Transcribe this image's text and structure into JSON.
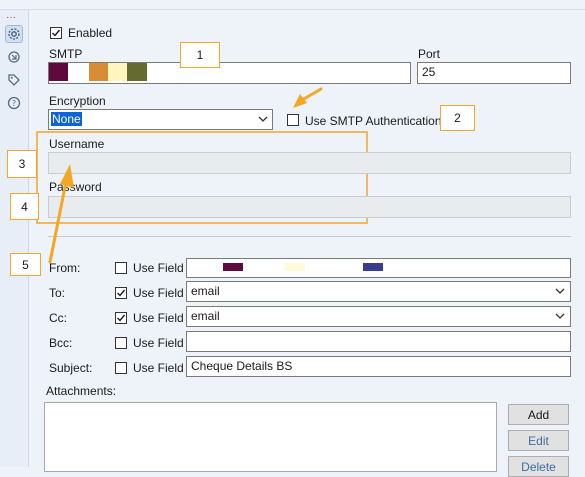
{
  "window": {
    "title_fragment": ""
  },
  "rail": {
    "dots": "···",
    "icons": [
      "gear-icon",
      "refresh-arrows-icon",
      "tag-icon",
      "help-icon"
    ]
  },
  "enabled": {
    "label": "Enabled",
    "checked": true
  },
  "smtp": {
    "label": "SMTP",
    "value": "",
    "redaction_colors": [
      "#5e0a3e",
      "#d88c36",
      "#fff5c0",
      "#656a30"
    ]
  },
  "port": {
    "label": "Port",
    "value": "25"
  },
  "encryption": {
    "label": "Encryption",
    "value": "None"
  },
  "smtp_auth": {
    "label": "Use SMTP Authentication",
    "checked": false
  },
  "username": {
    "label": "Username",
    "value": ""
  },
  "password": {
    "label": "Password",
    "value": ""
  },
  "callouts": {
    "c1": "1",
    "c2": "2",
    "c3": "3",
    "c4": "4",
    "c5": "5"
  },
  "fields": {
    "use_field_label": "Use Field",
    "from": {
      "label": "From:",
      "use_field": false,
      "value": "",
      "redaction_colors": [
        "#5e0a3e",
        "#fffbd8",
        "#3b3d8a"
      ]
    },
    "to": {
      "label": "To:",
      "use_field": true,
      "value": "email"
    },
    "cc": {
      "label": "Cc:",
      "use_field": true,
      "value": "email"
    },
    "bcc": {
      "label": "Bcc:",
      "use_field": false,
      "value": ""
    },
    "subject": {
      "label": "Subject:",
      "use_field": false,
      "value": "Cheque Details BS"
    }
  },
  "attachments": {
    "label": "Attachments:"
  },
  "buttons": {
    "add": "Add",
    "edit": "Edit",
    "delete": "Delete"
  },
  "colors": {
    "callout_border": "#f0a62f",
    "arrow": "#f5a623",
    "selection": "#0a64d6"
  }
}
